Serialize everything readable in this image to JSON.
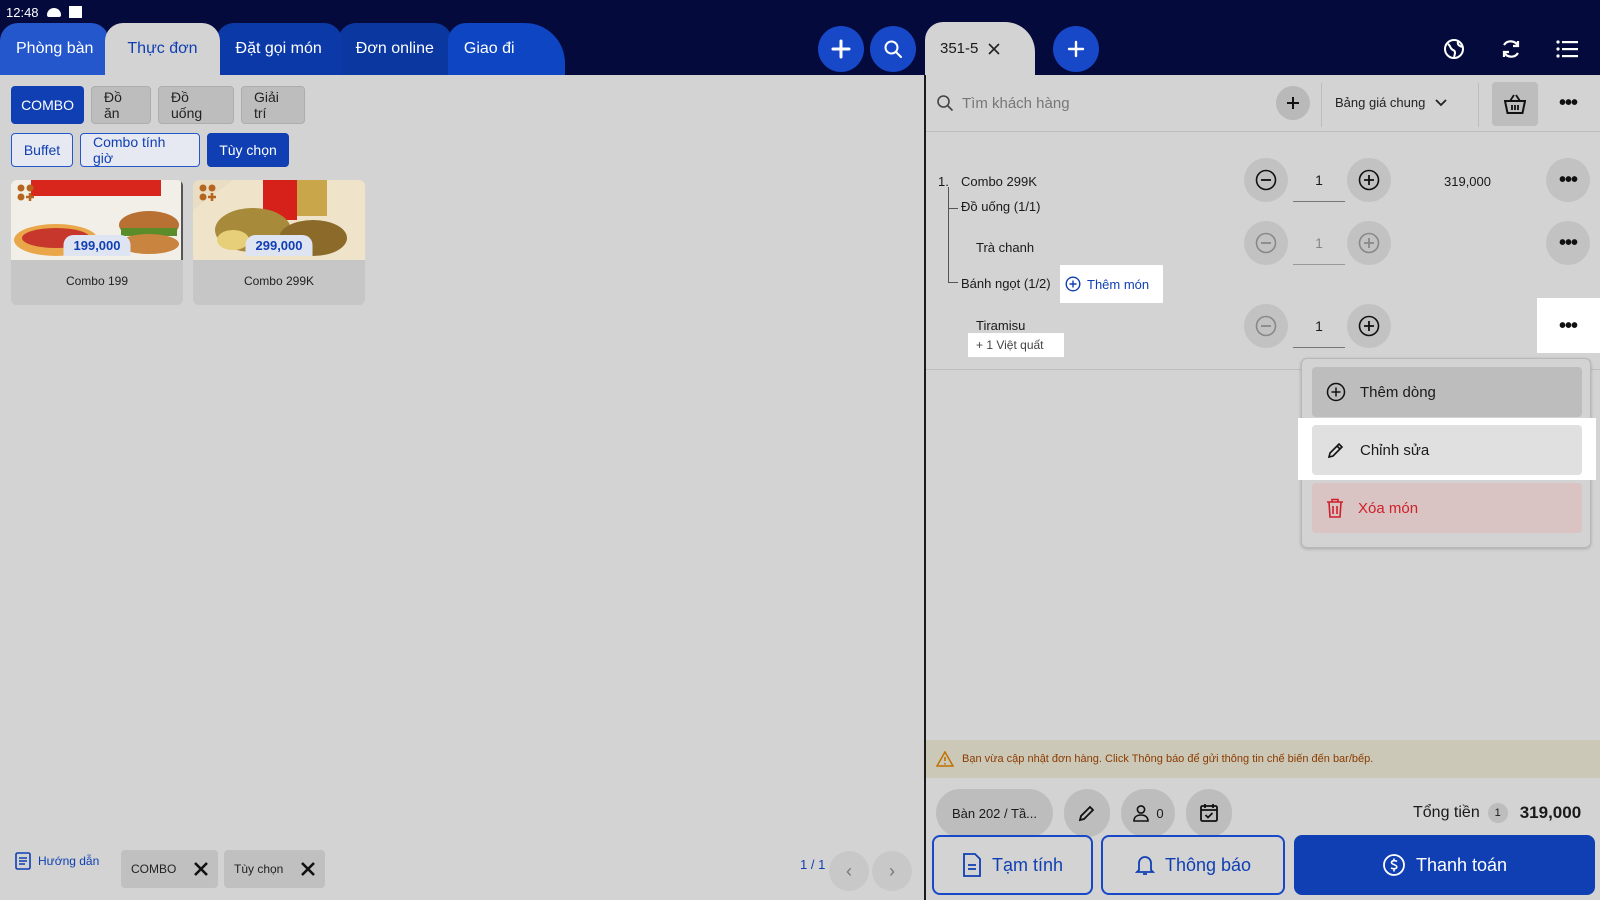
{
  "status": {
    "time": "12:48"
  },
  "tabs": [
    "Phòng bàn",
    "Thực đơn",
    "Đặt gọi món",
    "Đơn online",
    "Giao đi"
  ],
  "order_tab": {
    "label": "351-5"
  },
  "categories": [
    "COMBO",
    "Đồ ăn",
    "Đồ uống",
    "Giải trí"
  ],
  "subcategories": [
    "Buffet",
    "Combo tính giờ",
    "Tùy chọn"
  ],
  "products": [
    {
      "name": "Combo 199",
      "price": "199,000"
    },
    {
      "name": "Combo 299K",
      "price": "299,000"
    }
  ],
  "footer_left": {
    "guide_label": "Hướng dẫn",
    "filters": [
      "COMBO",
      "Tùy chọn"
    ],
    "page": "1 / 1"
  },
  "customer": {
    "placeholder": "Tìm khách hàng",
    "price_list": "Bảng giá chung"
  },
  "order": {
    "item_index": "1.",
    "item_name": "Combo 299K",
    "item_qty": "1",
    "item_price": "319,000",
    "group_drinks": "Đồ uống (1/1)",
    "drink_item": "Trà chanh",
    "drink_qty": "1",
    "group_cakes": "Bánh ngọt (1/2)",
    "add_item_label": "Thêm món",
    "cake_item": "Tiramisu",
    "cake_qty": "1",
    "cake_topping": "+ 1 Việt quất"
  },
  "context_menu": {
    "add_line": "Thêm dòng",
    "edit": "Chỉnh sửa",
    "delete": "Xóa món"
  },
  "warning": "Bạn vừa cập nhật đơn hàng. Click Thông báo để gửi thông tin chế biến đến bar/bếp.",
  "summary": {
    "table": "Bàn 202 / Tầ...",
    "guests": "0",
    "total_label": "Tổng tiền",
    "total_count": "1",
    "total_value": "319,000"
  },
  "actions": {
    "provisional": "Tạm tính",
    "notify": "Thông báo",
    "pay": "Thanh toán"
  },
  "colors": {
    "primary": "#0f3fb3",
    "topbar": "#050a3c",
    "danger": "#d0202a"
  }
}
